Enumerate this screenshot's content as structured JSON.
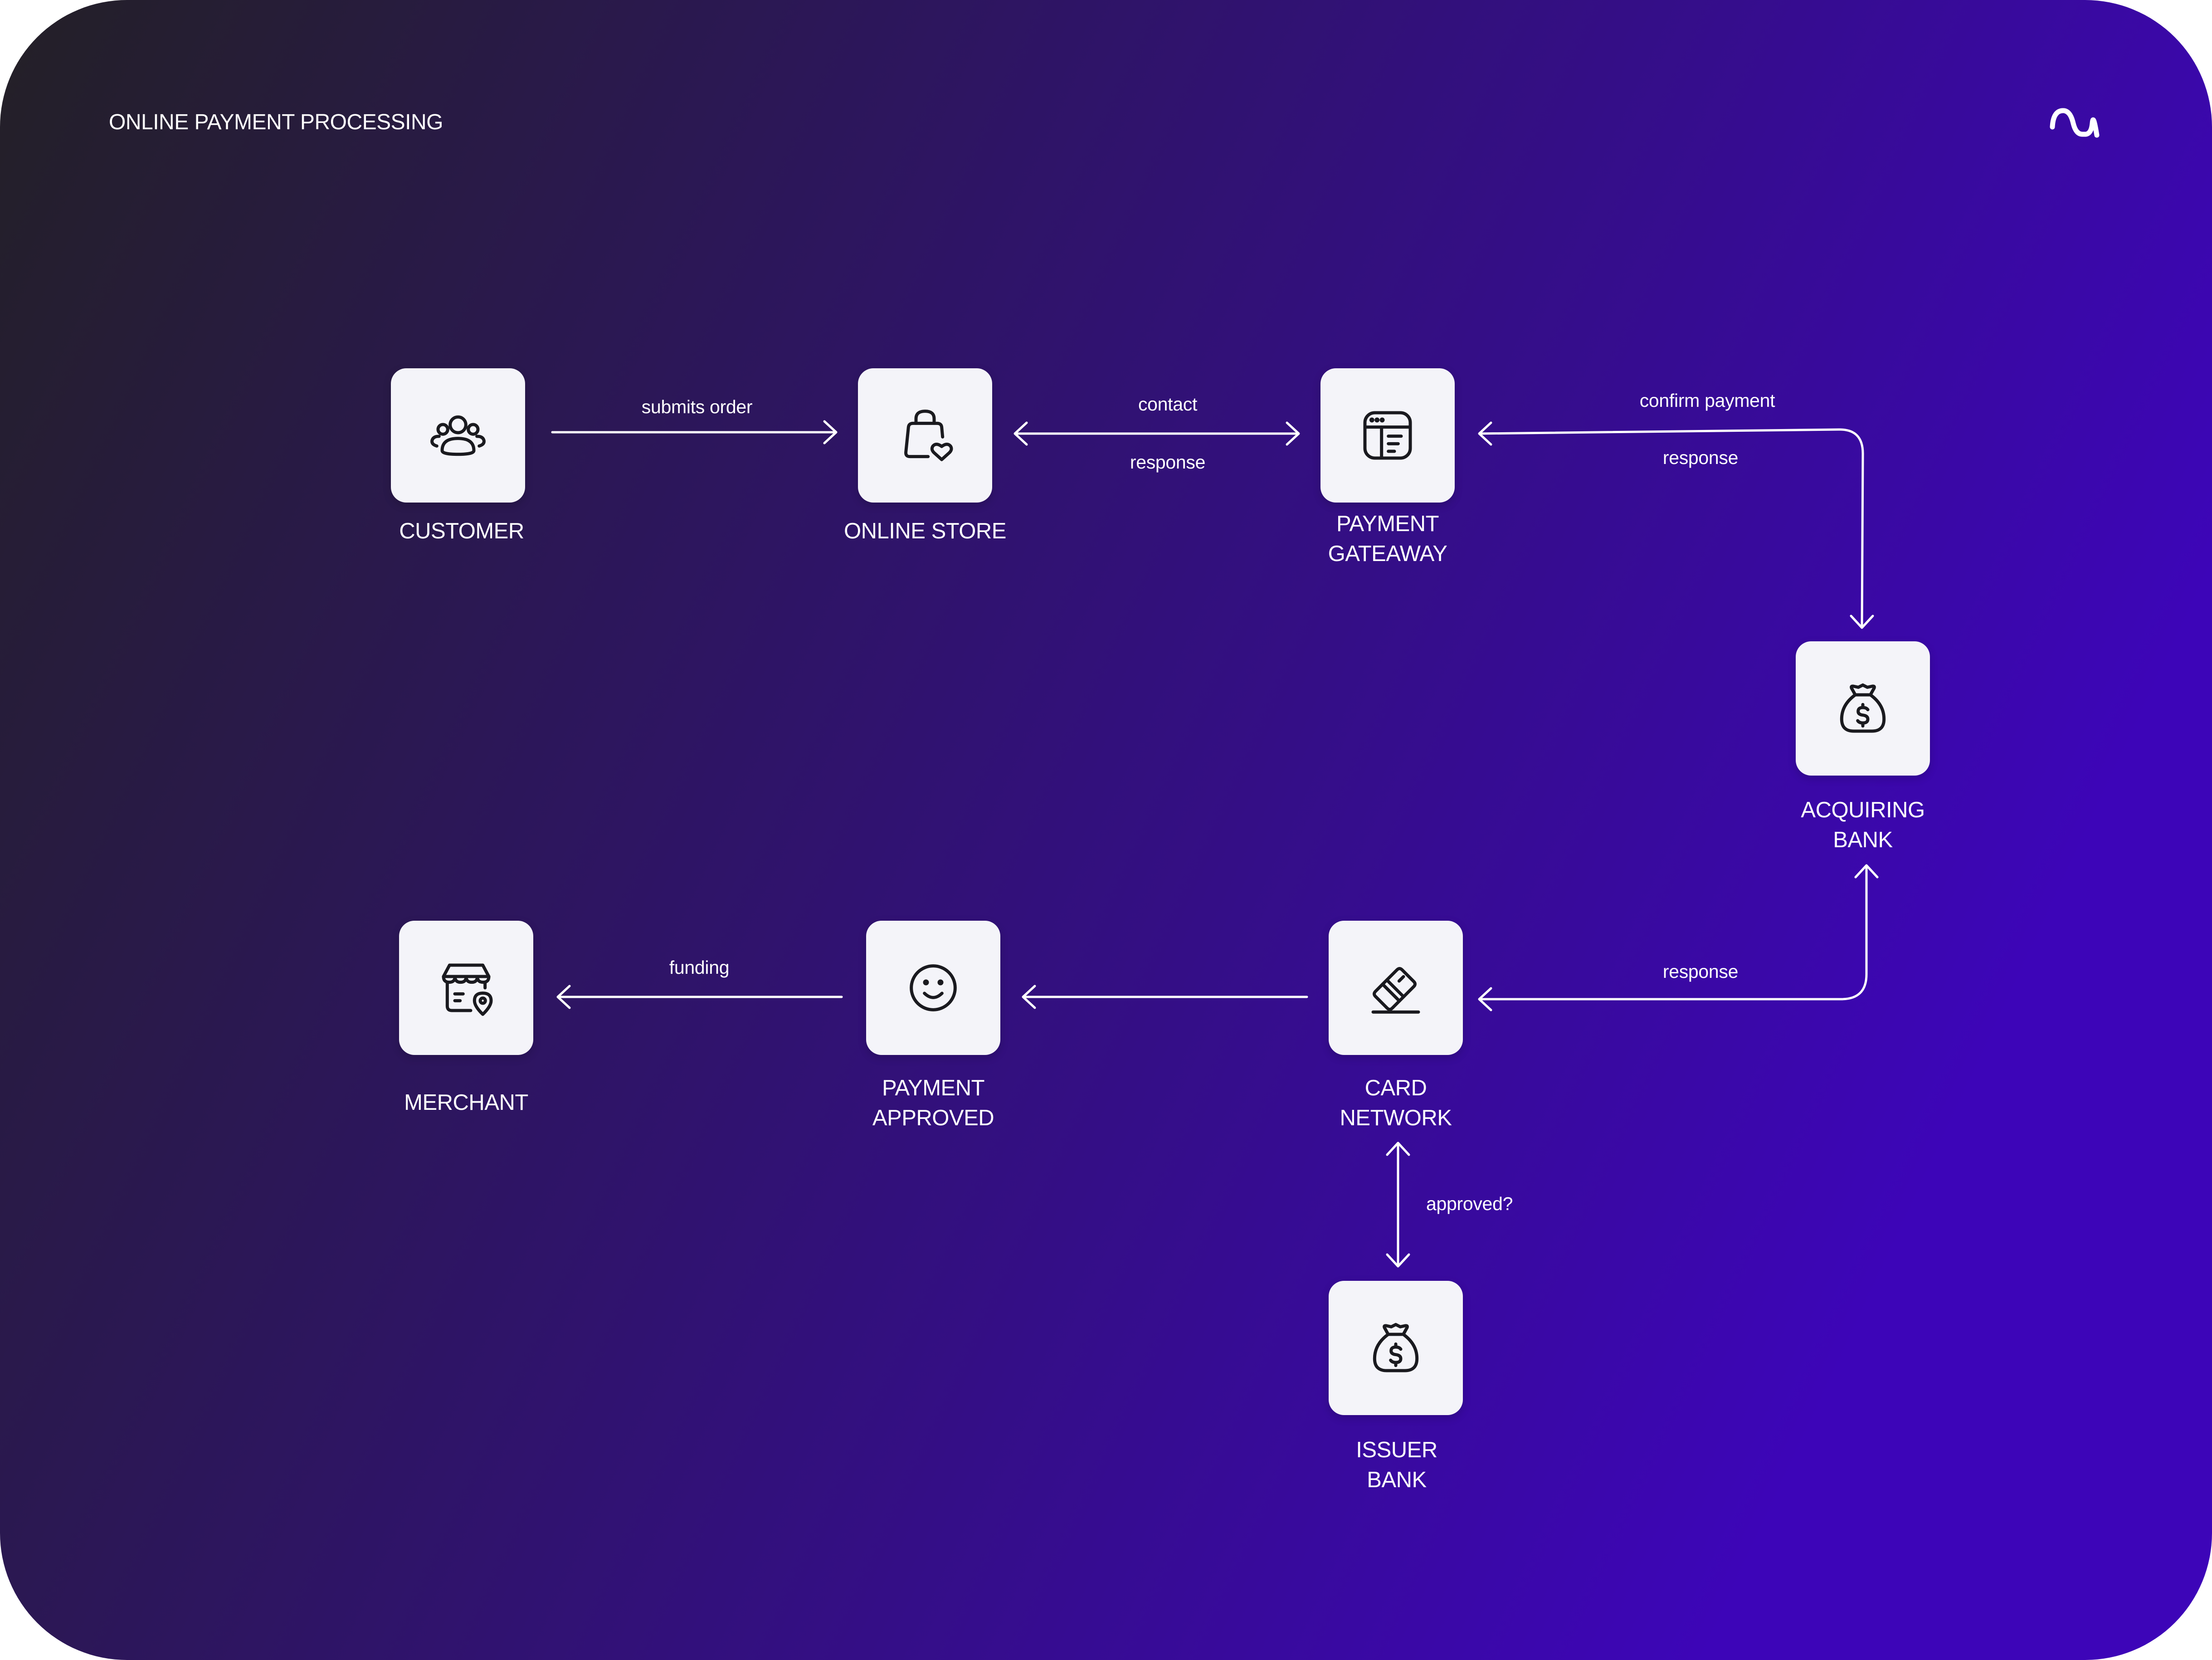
{
  "title": "ONLINE PAYMENT PROCESSING",
  "colors": {
    "background_start": "#232026",
    "background_end": "#3d05b8",
    "node_fill": "#f4f4f9",
    "icon_stroke": "#1a1a1f",
    "line": "#ffffff"
  },
  "nodes": {
    "customer": {
      "lines": [
        "CUSTOMER"
      ],
      "icon": "users-icon"
    },
    "online_store": {
      "lines": [
        "ONLINE STORE"
      ],
      "icon": "shopping-bag-heart-icon"
    },
    "payment_gateway": {
      "lines": [
        "PAYMENT",
        "GATEAWAY"
      ],
      "icon": "browser-window-icon"
    },
    "acquiring_bank": {
      "lines": [
        "ACQUIRING",
        "BANK"
      ],
      "icon": "money-bag-icon"
    },
    "card_network": {
      "lines": [
        "CARD",
        "NETWORK"
      ],
      "icon": "credit-card-icon"
    },
    "payment_approved": {
      "lines": [
        "PAYMENT",
        "APPROVED"
      ],
      "icon": "smiley-face-icon"
    },
    "merchant": {
      "lines": [
        "MERCHANT"
      ],
      "icon": "store-location-icon"
    },
    "issuer_bank": {
      "lines": [
        "ISSUER",
        "BANK"
      ],
      "icon": "money-bag-icon"
    }
  },
  "edges": {
    "submits_order": "submits order",
    "contact": "contact",
    "store_gateway_response": "response",
    "confirm_payment": "confirm payment",
    "gateway_acquiring_response": "response",
    "network_acquiring_response": "response",
    "approved": "approved?",
    "funding": "funding"
  }
}
